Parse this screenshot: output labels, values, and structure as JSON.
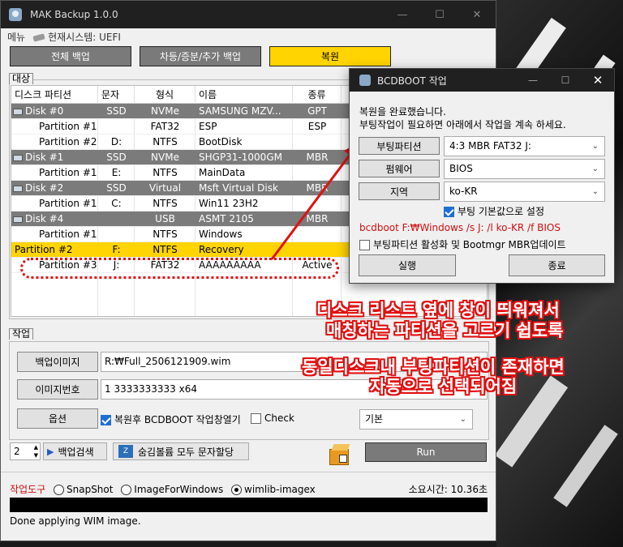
{
  "app": {
    "title": "MAK Backup 1.0.0",
    "menu": {
      "menu_label": "메뉴",
      "system_label": "현재시스템: UEFI"
    },
    "tabs": [
      {
        "label": "전체 백업",
        "active": false
      },
      {
        "label": "차등/증분/추가 백업",
        "active": false
      },
      {
        "label": "복원",
        "active": true
      }
    ],
    "target_group_label": "대상",
    "table": {
      "headers": [
        "디스크 파티션",
        "문자",
        "형식",
        "이름",
        "종류",
        ""
      ],
      "rows": [
        {
          "type": "disk",
          "cells": [
            "Disk #0",
            "SSD",
            "NVMe",
            "SAMSUNG MZV...",
            "GPT",
            ""
          ]
        },
        {
          "type": "part",
          "cells": [
            "Partition #1",
            "",
            "FAT32",
            "ESP",
            "ESP",
            ""
          ]
        },
        {
          "type": "part",
          "cells": [
            "Partition #2",
            "D:",
            "NTFS",
            "BootDisk",
            "",
            ""
          ]
        },
        {
          "type": "disk",
          "cells": [
            "Disk #1",
            "SSD",
            "NVMe",
            "SHGP31-1000GM",
            "MBR",
            ""
          ]
        },
        {
          "type": "part",
          "cells": [
            "Partition #1",
            "E:",
            "NTFS",
            "MainData",
            "",
            ""
          ]
        },
        {
          "type": "disk",
          "cells": [
            "Disk #2",
            "SSD",
            "Virtual",
            "Msft Virtual Disk",
            "MBR",
            ""
          ]
        },
        {
          "type": "part",
          "cells": [
            "Partition #1",
            "C:",
            "NTFS",
            "Win11 23H2",
            "",
            ""
          ]
        },
        {
          "type": "disk",
          "cells": [
            "Disk #4",
            "",
            "USB",
            "ASMT 2105",
            "MBR",
            ""
          ]
        },
        {
          "type": "part",
          "cells": [
            "Partition #1",
            "",
            "NTFS",
            "Windows",
            "",
            ""
          ]
        },
        {
          "type": "sel",
          "cells": [
            "Partition #2",
            "F:",
            "NTFS",
            "Recovery",
            "",
            ""
          ]
        },
        {
          "type": "part",
          "cells": [
            "Partition #3",
            "J:",
            "FAT32",
            "AAAAAAAAA",
            "Active",
            ""
          ]
        }
      ]
    },
    "job": {
      "group_label": "작업",
      "backup_image_btn": "백업이미지",
      "backup_image_path": "R:₩Full_2506121909.wim",
      "image_number_btn": "이미지번호",
      "image_number_value": "1 3333333333 x64",
      "options_btn": "옵션",
      "open_bcdboot_label": "복원후 BCDBOOT 작업창열기",
      "check_label": "Check",
      "preset_value": "기본"
    },
    "bottom": {
      "spinner_value": "2",
      "search_backup_btn": "백업검색",
      "assign_letters_btn": "숨김볼륨 모두 문자할당",
      "run_btn": "Run",
      "tool_label": "작업도구",
      "tools": [
        "SnapShot",
        "ImageForWindows",
        "wimlib-imagex"
      ],
      "selected_tool": "wimlib-imagex",
      "elapsed": "소요시간: 10.36초",
      "status": "Done applying WIM image."
    }
  },
  "dialog": {
    "title": "BCDBOOT 작업",
    "message_line1": "복원을 완료했습니다.",
    "message_line2": "부팅작업이 필요하면 아래에서 작업을 계속 하세요.",
    "boot_partition_btn": "부팅파티션",
    "boot_partition_value": "4:3 MBR FAT32 J:",
    "firmware_btn": "펌웨어",
    "firmware_value": "BIOS",
    "locale_btn": "지역",
    "locale_value": "ko-KR",
    "boot_default_label": "부팅 기본값으로 설정",
    "command_text": "bcdboot F:₩Windows /s J: /l ko-KR /f BIOS",
    "activate_label": "부팅파티션 활성화 및 Bootmgr MBR업데이트",
    "run_btn": "실행",
    "close_btn": "종료"
  },
  "annotations": {
    "line1": "디스크 리스트 옆에 창이 띄워져서",
    "line2": "매칭하는 파티션을 고르기 쉽도록",
    "line3": "동일디스크내 부팅파티션이 존재하면",
    "line4": "자동으로 선택되어짐"
  },
  "colors": {
    "accent_yellow": "#ffd400",
    "disk_row_gray": "#7b7b7b",
    "annotation_red": "#e01010",
    "tool_label_red": "#d01010"
  }
}
